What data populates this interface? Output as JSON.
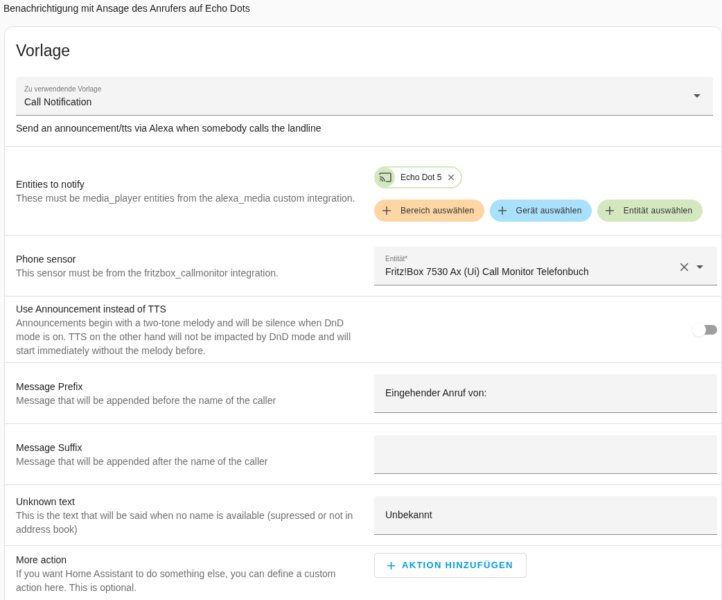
{
  "page_title": "Benachrichtigung mit Ansage des Anrufers auf Echo Dots",
  "card": {
    "title": "Vorlage",
    "template_select": {
      "label": "Zu verwendende Vorlage",
      "value": "Call Notification"
    },
    "description": "Send an announcement/tts via Alexa when somebody calls the landline",
    "rows": [
      {
        "kind": "targets",
        "label": "Entities to notify",
        "description": "These must be media_player entities from the alexa_media custom integration.",
        "chips": [
          {
            "label": "Echo Dot 5",
            "color": "#d4e8c0"
          }
        ],
        "add_buttons": [
          {
            "label": "Bereich auswählen",
            "color": "#fdd6a4"
          },
          {
            "label": "Gerät auswählen",
            "color": "#a9e0fb"
          },
          {
            "label": "Entität auswählen",
            "color": "#d4e8c0"
          }
        ]
      },
      {
        "kind": "entity_select",
        "label": "Phone sensor",
        "description": "This sensor must be from the fritzbox_callmonitor integration.",
        "field_label": "Entität*",
        "value": "Fritz!Box 7530 Ax (Ui) Call Monitor Telefonbuch"
      },
      {
        "kind": "toggle",
        "label": "Use Announcement instead of TTS",
        "description": "Announcements begin with a two-tone melody and will be silence when DnD mode is on. TTS on the other hand will not be impacted by DnD mode and will start immediately without the melody before.",
        "on": false
      },
      {
        "kind": "text",
        "label": "Message Prefix",
        "description": "Message that will be appended before the name of the caller",
        "value": "Eingehender Anruf von:"
      },
      {
        "kind": "text",
        "label": "Message Suffix",
        "description": "Message that will be appended after the name of the caller"
      },
      {
        "kind": "text",
        "label": "Unknown text",
        "description": "This is the text that will be said when no name is available (supressed or not in address book)",
        "value": "Unbekannt"
      },
      {
        "kind": "button",
        "label": "More action",
        "description": "If you want Home Assistant to do something else, you can define a custom action here. This is optional.",
        "button": "AKTION HINZUFÜGEN"
      }
    ]
  }
}
